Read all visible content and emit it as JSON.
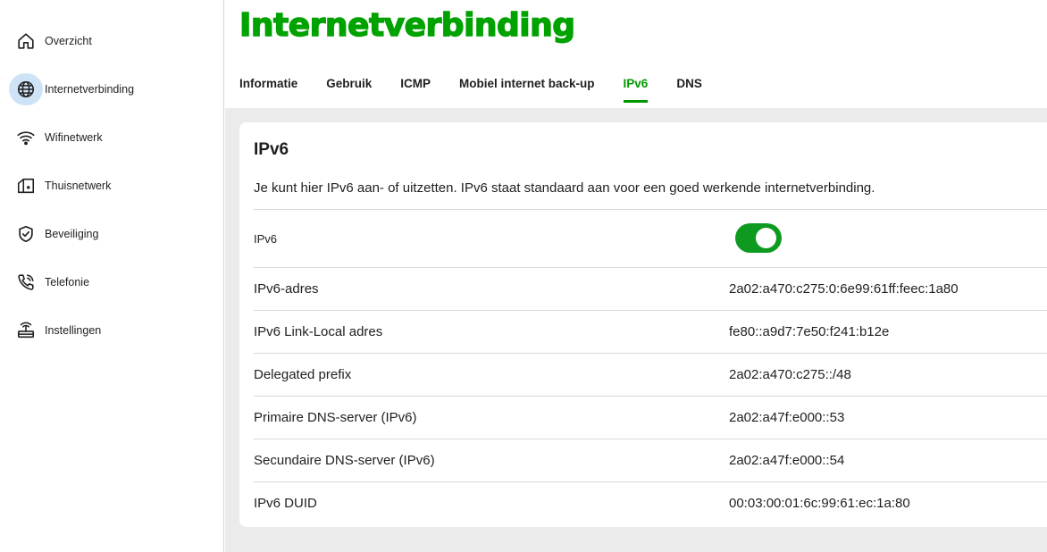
{
  "sidebar": {
    "items": [
      {
        "label": "Overzicht",
        "icon": "home-icon"
      },
      {
        "label": "Internetverbinding",
        "icon": "globe-icon",
        "active": true
      },
      {
        "label": "Wifinetwerk",
        "icon": "wifi-icon"
      },
      {
        "label": "Thuisnetwerk",
        "icon": "house-network-icon"
      },
      {
        "label": "Beveiliging",
        "icon": "shield-check-icon"
      },
      {
        "label": "Telefonie",
        "icon": "phone-icon"
      },
      {
        "label": "Instellingen",
        "icon": "router-icon"
      }
    ]
  },
  "header": {
    "title": "Internetverbinding",
    "tabs": [
      {
        "label": "Informatie"
      },
      {
        "label": "Gebruik"
      },
      {
        "label": "ICMP"
      },
      {
        "label": "Mobiel internet back-up"
      },
      {
        "label": "IPv6",
        "active": true
      },
      {
        "label": "DNS"
      }
    ]
  },
  "card": {
    "title": "IPv6",
    "description": "Je kunt hier IPv6 aan- of uitzetten. IPv6 staat standaard aan voor een goed werkende internetverbinding.",
    "toggle": {
      "label": "IPv6",
      "enabled": true
    },
    "rows": [
      {
        "label": "IPv6-adres",
        "value": "2a02:a470:c275:0:6e99:61ff:feec:1a80"
      },
      {
        "label": "IPv6 Link-Local adres",
        "value": "fe80::a9d7:7e50:f241:b12e"
      },
      {
        "label": "Delegated prefix",
        "value": "2a02:a470:c275::/48"
      },
      {
        "label": "Primaire DNS-server (IPv6)",
        "value": "2a02:a47f:e000::53"
      },
      {
        "label": "Secundaire DNS-server (IPv6)",
        "value": "2a02:a47f:e000::54"
      },
      {
        "label": "IPv6 DUID",
        "value": "00:03:00:01:6c:99:61:ec:1a:80"
      }
    ]
  },
  "colors": {
    "brand_green": "#00a200",
    "toggle_on": "#0d9a1f",
    "active_nav_bg": "#cfe3f6"
  }
}
